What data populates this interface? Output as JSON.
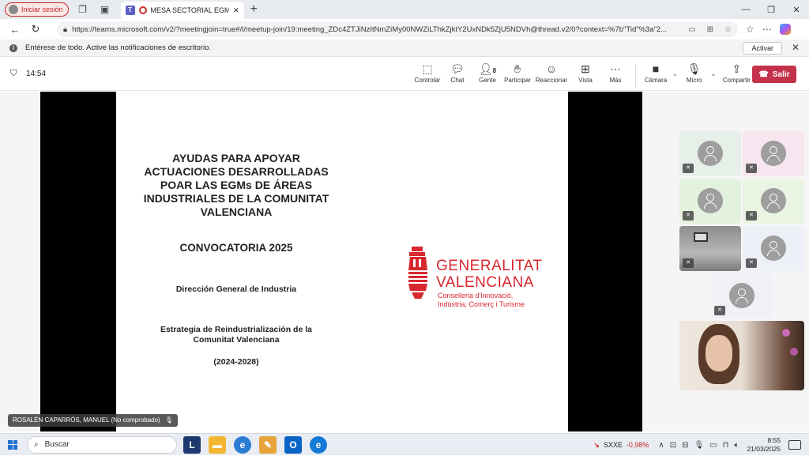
{
  "browser": {
    "signin_label": "Iniciar sesión",
    "tab_title": "MESA SECTORIAL EGMs | Mi",
    "url": "https://teams.microsoft.com/v2/?meetingjoin=true#/l/meetup-join/19:meeting_ZDc4ZTJiNzItNmZiMy00NWZiLThkZjktY2UxNDk5ZjU5NDVh@thread.v2/0?context=%7b\"Tid\"%3a\"2..."
  },
  "notification": {
    "text": "Entérese de todo. Active las notificaciones de escritorio.",
    "button_label": "Activar"
  },
  "meeting": {
    "timer": "14:54",
    "toolbar": [
      {
        "label": "Controlar",
        "icon": "control-icon"
      },
      {
        "label": "Chat",
        "icon": "chat-icon"
      },
      {
        "label": "Gente",
        "icon": "people-icon",
        "count": "8"
      },
      {
        "label": "Participar",
        "icon": "raise-hand-icon"
      },
      {
        "label": "Reaccionar",
        "icon": "react-icon"
      },
      {
        "label": "Vista",
        "icon": "view-icon"
      },
      {
        "label": "Más",
        "icon": "more-icon"
      }
    ],
    "media": [
      {
        "label": "Cámara",
        "icon": "camera-icon"
      },
      {
        "label": "Micro",
        "icon": "mic-icon"
      },
      {
        "label": "Compartir",
        "icon": "share-icon"
      }
    ],
    "leave_label": "Salir",
    "presenter_name": "ROSALÉN CAPARRÓS, MANUEL (No comprobado)"
  },
  "slide": {
    "title": "AYUDAS PARA APOYAR ACTUACIONES DESARROLLADAS POAR LAS EGMs DE ÁREAS INDUSTRIALES DE LA COMUNITAT VALENCIANA",
    "convocatoria": "CONVOCATORIA 2025",
    "direccion": "Dirección General de Industria",
    "estrategia": "Estrategia de Reindustrialización de la Comunitat Valenciana",
    "periodo": "(2024-2028)",
    "org_line1": "GENERALITAT",
    "org_line2": "VALENCIANA",
    "conselleria_line1": "Conselleria d'Innovació,",
    "conselleria_line2": "Indústria, Comerç i Turisme",
    "brand_color": "#d8282f"
  },
  "participants": [
    {
      "bg": "#e6efe8",
      "type": "avatar"
    },
    {
      "bg": "#f7e6ef",
      "type": "avatar"
    },
    {
      "bg": "#e3f2df",
      "type": "avatar"
    },
    {
      "bg": "#eaf4e3",
      "type": "avatar"
    },
    {
      "bg": "#6b6b6b",
      "type": "video"
    },
    {
      "bg": "#eef0f8",
      "type": "avatar"
    },
    {
      "bg": "#f2eff6",
      "type": "avatar"
    },
    {
      "bg": "#d9c8b8",
      "type": "video"
    }
  ],
  "taskbar": {
    "search_placeholder": "Buscar",
    "stock_name": "SXXE",
    "stock_change": "-0,98%",
    "time": "8:55",
    "date": "21/03/2025"
  }
}
